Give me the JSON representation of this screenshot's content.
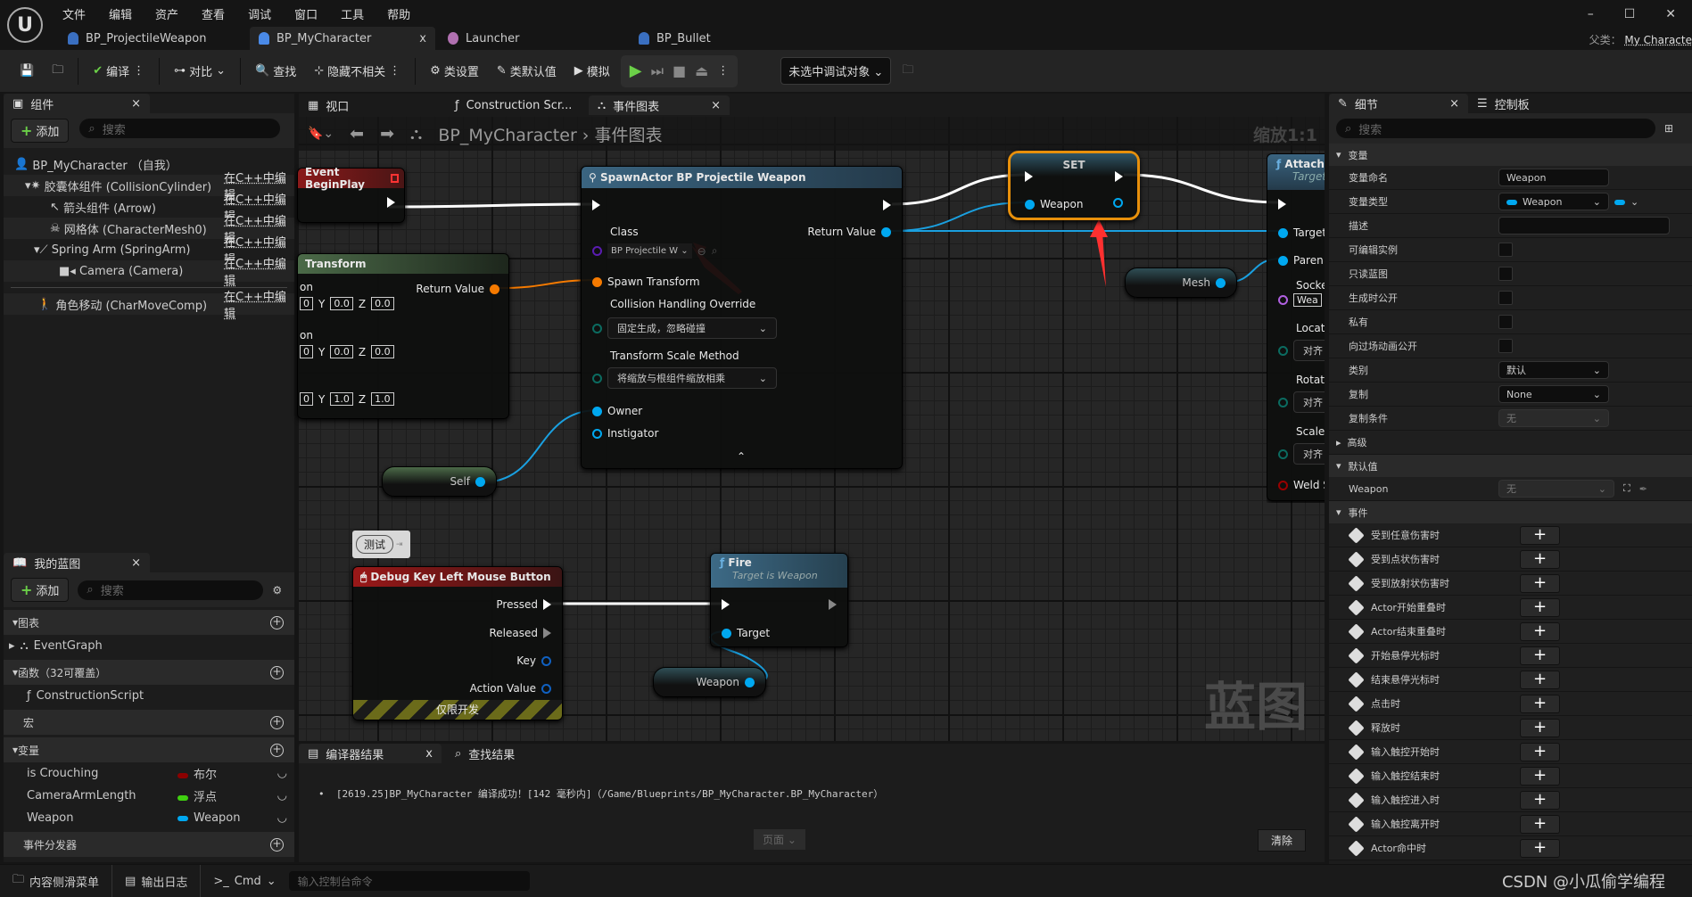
{
  "menu": [
    "文件",
    "编辑",
    "资产",
    "查看",
    "调试",
    "窗口",
    "工具",
    "帮助"
  ],
  "doc_tabs": [
    {
      "label": "BP_ProjectileWeapon"
    },
    {
      "label": "BP_MyCharacter",
      "active": true,
      "close": "x"
    },
    {
      "label": "Launcher"
    },
    {
      "label": "BP_Bullet"
    }
  ],
  "parent_class": {
    "label": "父类：",
    "value": "My Characte"
  },
  "window_controls": [
    "–",
    "☐",
    "✕"
  ],
  "toolbar": {
    "compile": "编译",
    "diff": "对比",
    "find": "查找",
    "hide_unrelated": "隐藏不相关",
    "class_settings": "类设置",
    "class_defaults": "类默认值",
    "simulate": "模拟",
    "debug_target": "未选中调试对象"
  },
  "components": {
    "title": "组件",
    "add": "添加",
    "search_placeholder": "搜索",
    "items": [
      {
        "label": "BP_MyCharacter （自我）",
        "edit": ""
      },
      {
        "label": "胶囊体组件 (CollisionCylinder)",
        "edit": "在C++中编辑"
      },
      {
        "label": "箭头组件 (Arrow)",
        "edit": "在C++中编辑"
      },
      {
        "label": "网格体 (CharacterMesh0)",
        "edit": "在C++中编辑"
      },
      {
        "label": "Spring Arm (SpringArm)",
        "edit": "在C++中编辑"
      },
      {
        "label": "Camera (Camera)",
        "edit": "在C++中编辑"
      },
      {
        "label": "角色移动 (CharMoveComp)",
        "edit": "在C++中编辑"
      }
    ]
  },
  "my_blueprint": {
    "title": "我的蓝图",
    "add": "添加",
    "search_placeholder": "搜索",
    "graphs": "图表",
    "event_graph": "EventGraph",
    "functions": "函数（32可覆盖）",
    "construction": "ConstructionScript",
    "macros": "宏",
    "variables": "变量",
    "vars": [
      {
        "name": "is Crouching",
        "type": "布尔",
        "color": "#8b0000"
      },
      {
        "name": "CameraArmLength",
        "type": "浮点",
        "color": "#3fcf10"
      },
      {
        "name": "Weapon",
        "type": "Weapon",
        "color": "#00a8f0"
      }
    ],
    "dispatchers": "事件分发器"
  },
  "editor_tabs": {
    "viewport": "视口",
    "construction": "Construction Scr...",
    "event_graph": "事件图表"
  },
  "breadcrumb": {
    "root": "BP_MyCharacter",
    "current": "事件图表"
  },
  "zoom_label": "缩放1:1",
  "watermark": "蓝图",
  "nodes": {
    "begin_play": "Event BeginPlay",
    "make_transform": {
      "title": "Transform",
      "return": "Return Value",
      "row1": "on",
      "row2": "on",
      "rows": [
        [
          "0",
          "0.0",
          "0.0"
        ],
        [
          "0",
          "0.0",
          "0.0"
        ],
        [
          "0",
          "1.0",
          "1.0"
        ]
      ],
      "y": "Y",
      "z": "Z"
    },
    "spawn": {
      "title": "SpawnActor BP Projectile Weapon",
      "class_label": "Class",
      "class_value": "BP Projectile W",
      "return": "Return Value",
      "spawn_transform": "Spawn Transform",
      "collision_label": "Collision Handling Override",
      "collision_value": "固定生成，忽略碰撞",
      "scale_label": "Transform Scale Method",
      "scale_value": "将缩放与根组件缩放相乘",
      "owner": "Owner",
      "instigator": "Instigator"
    },
    "set": {
      "title": "SET",
      "pin": "Weapon"
    },
    "attach": {
      "title": "Attach",
      "subtitle": "Target",
      "target": "Target",
      "parent": "Paren",
      "socket": "Socke",
      "socket_value": "Wea",
      "location": "Locati",
      "rotation": "Rotati",
      "scale": "Scale",
      "rule": "对齐",
      "weld": "Weld S"
    },
    "mesh": "Mesh",
    "self": "Self",
    "comment": "测试",
    "debug_key": {
      "title": "Debug Key Left Mouse Button",
      "pressed": "Pressed",
      "released": "Released",
      "key": "Key",
      "action_value": "Action Value",
      "dev_only": "仅限开发"
    },
    "fire": {
      "title": "Fire",
      "subtitle": "Target is Weapon",
      "target": "Target"
    },
    "weapon_getter": "Weapon"
  },
  "compiler": {
    "tab": "编译器结果",
    "close": "x",
    "find_tab": "查找结果",
    "message": "[2619.25]BP_MyCharacter 编译成功！[142 毫秒内]（/Game/Blueprints/BP_MyCharacter.BP_MyCharacter）",
    "page": "页面",
    "clear": "清除"
  },
  "details": {
    "tab": "细节",
    "close": "×",
    "tab2": "控制板",
    "search_placeholder": "搜索",
    "section_var": "变量",
    "var_name_label": "变量命名",
    "var_name": "Weapon",
    "var_type_label": "变量类型",
    "var_type": "Weapon",
    "desc_label": "描述",
    "checks": [
      "可编辑实例",
      "只读蓝图",
      "生成时公开",
      "私有",
      "向过场动画公开"
    ],
    "category_label": "类别",
    "category": "默认",
    "replication_label": "复制",
    "replication": "None",
    "rep_cond_label": "复制条件",
    "rep_cond": "无",
    "advanced": "高级",
    "defaults": "默认值",
    "default_var": "Weapon",
    "default_value": "无",
    "events": "事件",
    "event_items": [
      "受到任意伤害时",
      "受到点状伤害时",
      "受到放射状伤害时",
      "Actor开始重叠时",
      "Actor结束重叠时",
      "开始悬停光标时",
      "结束悬停光标时",
      "点击时",
      "释放时",
      "输入触控开始时",
      "输入触控结束时",
      "输入触控进入时",
      "输入触控离开时",
      "Actor命中时"
    ]
  },
  "statusbar": {
    "drawer": "内容侧滑菜单",
    "output_log": "输出日志",
    "cmd": "Cmd",
    "console_placeholder": "输入控制台命令"
  },
  "watermark_csdn": "CSDN @小瓜偷学编程",
  "colors": {
    "exec": "#ffffff",
    "object_pin": "#00a8f0",
    "transform_pin": "#f57a00",
    "class_pin": "#5a1cb0",
    "selection": "#e8900b",
    "event_header": "#8a1a1a",
    "function_header": "#3d6a86",
    "annotation_arrow": "#ff3030"
  }
}
